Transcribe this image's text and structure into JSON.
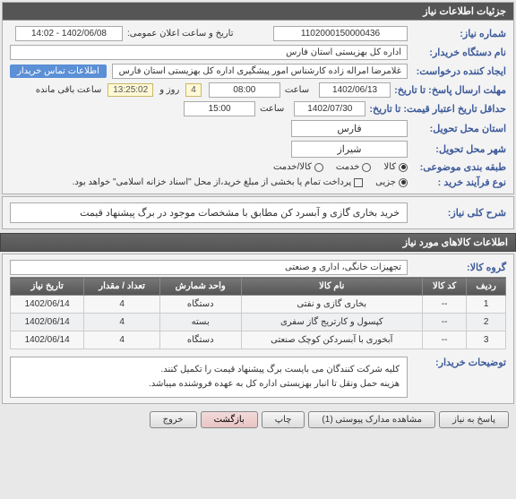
{
  "panel_title": "جزئیات اطلاعات نیاز",
  "fields": {
    "niaz_number_label": "شماره نیاز:",
    "niaz_number": "1102000150000436",
    "announce_label": "تاریخ و ساعت اعلان عمومی:",
    "announce_value": "1402/06/08 - 14:02",
    "buyer_name_label": "نام دستگاه خریدار:",
    "buyer_name": "اداره کل بهزیستی استان فارس",
    "request_creator_label": "ایجاد کننده درخواست:",
    "request_creator": "غلامرضا امراله زاده کارشناس امور پیشگیری اداره کل بهزیستی استان فارس",
    "contact_info_label": "اطلاعات تماس خریدار",
    "deadline_label": "مهلت ارسال پاسخ: تا تاریخ:",
    "deadline_date": "1402/06/13",
    "deadline_time_label": "ساعت",
    "deadline_time": "08:00",
    "remaining_days": "4",
    "remaining_days_label": "روز و",
    "remaining_time": "13:25:02",
    "remaining_time_label": "ساعت باقی مانده",
    "validity_label": "حداقل تاریخ اعتبار قیمت: تا تاریخ:",
    "validity_date": "1402/07/30",
    "validity_time": "15:00",
    "delivery_state_label": "استان محل تحویل:",
    "delivery_state": "فارس",
    "delivery_city_label": "شهر محل تحویل:",
    "delivery_city": "شیراز",
    "category_label": "طبقه بندی موضوعی:",
    "cat_goods": "کالا",
    "cat_service": "خدمت",
    "cat_goods_service": "کالا/خدمت",
    "process_type_label": "نوع فرآیند خرید :",
    "process_part": "جزیی",
    "process_partial_note": "پرداخت تمام یا بخشی از مبلغ خرید،از محل \"اسناد خزانه اسلامی\" خواهد بود.",
    "desc_label": "شرح کلی نیاز:",
    "desc_text": "خرید بخاری گازی و آبسرد کن مطابق با مشخصات موجود در برگ پیشنهاد قیمت",
    "goods_header": "اطلاعات کالاهای مورد نیاز",
    "goods_group_label": "گروه کالا:",
    "goods_group": "تجهیزات خانگی، اداری و صنعتی",
    "buyer_notes_label": "توضیحات خریدار:",
    "buyer_notes_1": "کلیه شرکت کنندگان می بایست برگ پیشنهاد قیمت را تکمیل کنند.",
    "buyer_notes_2": "هزینه حمل ونقل تا انبار بهزیستی اداره کل به عهده فروشنده میباشد."
  },
  "table": {
    "headers": [
      "ردیف",
      "کد کالا",
      "نام کالا",
      "واحد شمارش",
      "تعداد / مقدار",
      "تاریخ نیاز"
    ],
    "rows": [
      [
        "1",
        "--",
        "بخاری گازی و نفتی",
        "دستگاه",
        "4",
        "1402/06/14"
      ],
      [
        "2",
        "--",
        "کپسول و کارتریج گاز سفری",
        "بسته",
        "4",
        "1402/06/14"
      ],
      [
        "3",
        "--",
        "آبخوری با آبسردکن کوچک صنعتی",
        "دستگاه",
        "4",
        "1402/06/14"
      ]
    ]
  },
  "buttons": {
    "respond": "پاسخ به نیاز",
    "attachments": "مشاهده مدارک پیوستی  (1)",
    "print": "چاپ",
    "back": "بازگشت",
    "exit": "خروج"
  }
}
